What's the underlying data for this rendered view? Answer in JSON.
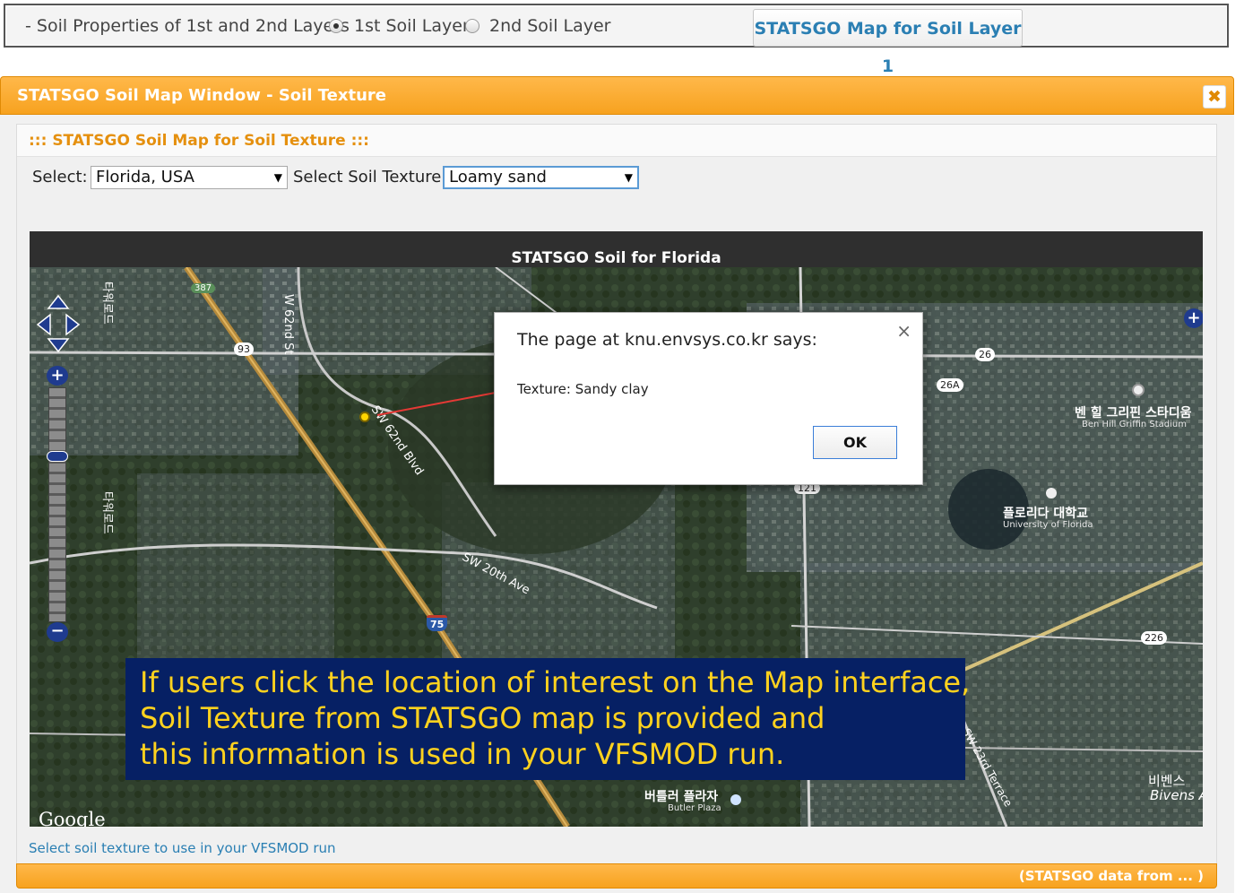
{
  "toolbar": {
    "soil_layers_label": "- Soil Properties of 1st and 2nd Layers",
    "radio_1_label": "1st Soil Layer",
    "radio_2_label": "2nd Soil Layer",
    "selected_layer": "1st Soil Layer",
    "map_button": "STATSGO Map for Soil Layer 1"
  },
  "window": {
    "title": "STATSGO Soil Map Window - Soil Texture",
    "close_glyph": "✖",
    "panel_title": "::: STATSGO Soil Map for Soil Texture :::",
    "select_label": "Select:",
    "select_value": "Florida, USA",
    "texture_label": "Select Soil Texture",
    "texture_value": "Loamy sand",
    "footnote": "Select soil texture to use in your VFSMOD run",
    "status": "(STATSGO data from ... )"
  },
  "map": {
    "header": "STATSGO Soil for Florida",
    "labels": {
      "road_62nd_st": "W 62nd St",
      "road_sw62nd_blvd": "SW 62nd Blvd",
      "road_sw20th": "SW 20th Ave",
      "road_sw23rd": "SW 23rd Terrace",
      "kr_road_1": "타워로드",
      "kr_road_2": "타워로드",
      "stadium_kr": "벤 힐 그리핀 스타디움",
      "stadium_en": "Ben Hill Griffin Stadium",
      "univ_kr": "플로리다 대학교",
      "univ_en": "University of Florida",
      "plaza_kr": "버틀러 플라자",
      "plaza_en": "Butler Plaza",
      "bivens_kr": "비벤스",
      "bivens_en": "Bivens A",
      "shield_387": "387",
      "shield_93": "93",
      "shield_26": "26",
      "shield_26a": "26A",
      "shield_121": "121",
      "shield_75": "75",
      "shield_226": "226",
      "google": "Google"
    }
  },
  "alert": {
    "message": "The page at knu.envsys.co.kr says:",
    "texture_line": "Texture:  Sandy clay",
    "ok": "OK",
    "close": "×"
  },
  "caption": {
    "line1": "If users click the location of interest on the Map interface,",
    "line2": "Soil Texture from STATSGO map is provided and",
    "line3": "this information is used in your VFSMOD run."
  }
}
